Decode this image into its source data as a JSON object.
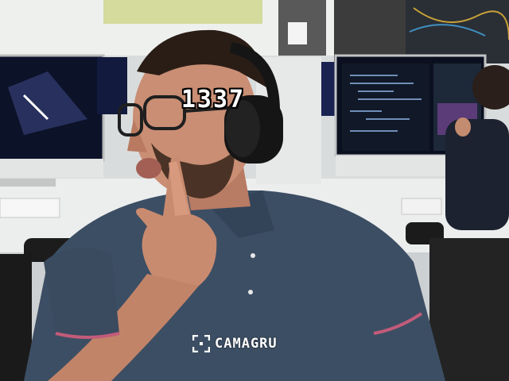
{
  "overlay": {
    "score_text": "1337"
  },
  "watermark": {
    "brand": "CAMAGRU",
    "icon": "camera-frame-icon"
  },
  "colors": {
    "shirt": "#3c4e63",
    "skin": "#c98e74",
    "headphones": "#151515",
    "screen_dark": "#0b1020",
    "desk": "#eceeee"
  }
}
